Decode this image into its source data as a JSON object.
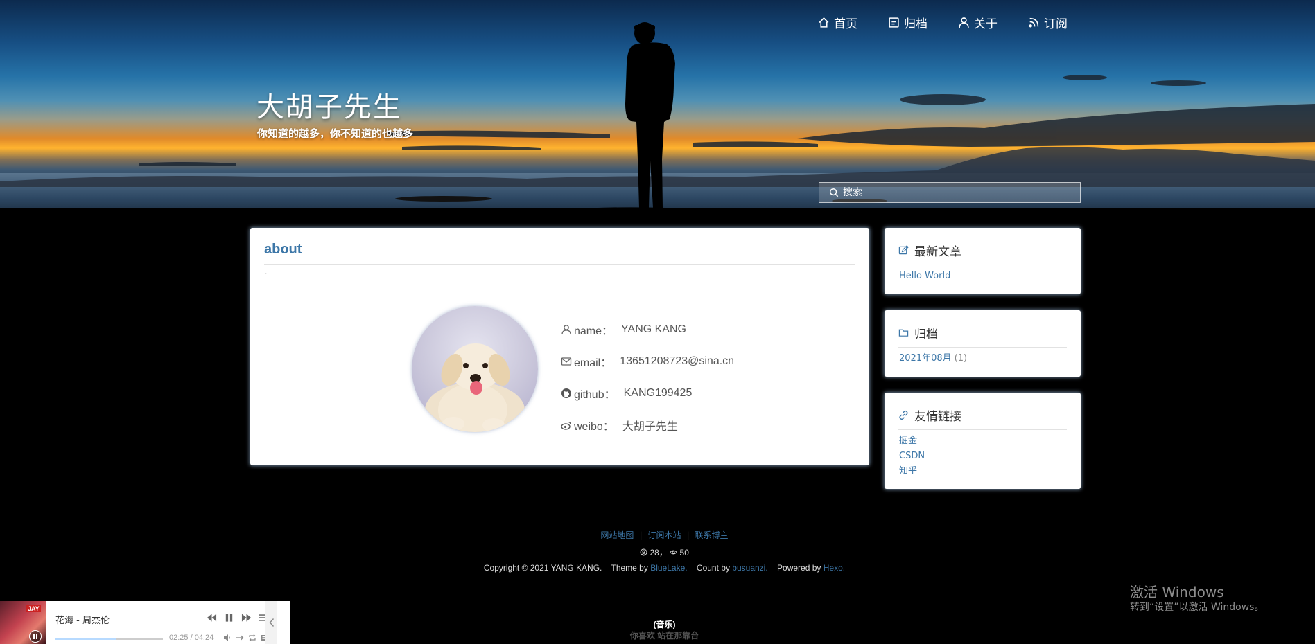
{
  "nav": {
    "items": [
      {
        "label": "首页",
        "icon": "home-icon"
      },
      {
        "label": "归档",
        "icon": "archive-icon"
      },
      {
        "label": "关于",
        "icon": "user-icon"
      },
      {
        "label": "订阅",
        "icon": "rss-icon"
      }
    ]
  },
  "site": {
    "title": "大胡子先生",
    "subtitle": "你知道的越多，你不知道的也越多"
  },
  "search": {
    "placeholder": "搜索"
  },
  "about": {
    "title": "about",
    "dot": ".",
    "fields": [
      {
        "label": "name：",
        "value": "YANG KANG",
        "icon": "user-icon"
      },
      {
        "label": "email：",
        "value": "13651208723@sina.cn",
        "icon": "mail-icon"
      },
      {
        "label": "github：",
        "value": "KANG199425",
        "icon": "github-icon"
      },
      {
        "label": "weibo：",
        "value": "大胡子先生",
        "icon": "weibo-icon"
      }
    ]
  },
  "sidebar": {
    "recent": {
      "title": "最新文章",
      "icon": "edit-icon",
      "items": [
        "Hello World"
      ]
    },
    "archive": {
      "title": "归档",
      "icon": "folder-icon",
      "items": [
        {
          "label": "2021年08月",
          "count": "(1)"
        }
      ]
    },
    "links": {
      "title": "友情链接",
      "icon": "link-icon",
      "items": [
        "掘金",
        "CSDN",
        "知乎"
      ]
    }
  },
  "footer": {
    "links": [
      "网站地图",
      "订阅本站",
      "联系博主"
    ],
    "sep": "|",
    "visitors": "28",
    "stats_sep": "，",
    "views": "50",
    "copyright": "Copyright © 2021 YANG KANG.",
    "theme_prefix": "Theme by",
    "theme_link": "BlueLake.",
    "count_prefix": "Count by",
    "count_link": "busuanzi.",
    "powered_prefix": "Powered by",
    "powered_link": "Hexo."
  },
  "music_note": {
    "line1": "(音乐)",
    "line2": "你喜欢 站在那靠台"
  },
  "watermark": {
    "title": "激活 Windows",
    "subtitle": "转到“设置”以激活 Windows。"
  },
  "player": {
    "song": "花海 - 周杰伦",
    "time": "02:25 / 04:24",
    "progress": 0.57,
    "cover_text": "JAY"
  }
}
